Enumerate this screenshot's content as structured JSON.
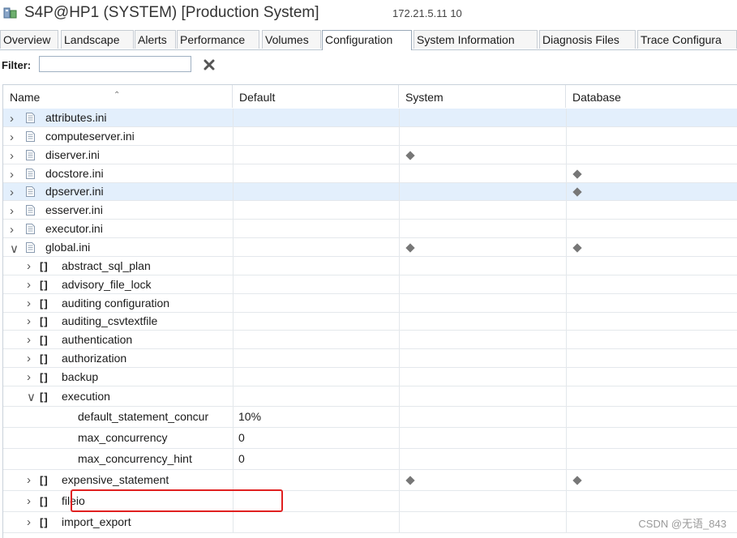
{
  "window": {
    "title": "S4P@HP1 (SYSTEM) [Production System]",
    "host": "172.21.5.11 10"
  },
  "tabs": [
    {
      "label": "Overview",
      "active": false
    },
    {
      "label": "Landscape",
      "active": false
    },
    {
      "label": "Alerts",
      "active": false
    },
    {
      "label": "Performance",
      "active": false
    },
    {
      "label": "Volumes",
      "active": false
    },
    {
      "label": "Configuration",
      "active": true
    },
    {
      "label": "System Information",
      "active": false
    },
    {
      "label": "Diagnosis Files",
      "active": false
    },
    {
      "label": "Trace Configura",
      "active": false
    }
  ],
  "filter": {
    "label": "Filter:",
    "value": "",
    "clear_icon": "x-clear-icon"
  },
  "columns": [
    "Name",
    "Default",
    "System",
    "Database"
  ],
  "rows": [
    {
      "name": "attributes.ini",
      "kind": "file",
      "expanded": false,
      "default": "",
      "system": false,
      "database": false,
      "selected": true
    },
    {
      "name": "computeserver.ini",
      "kind": "file",
      "expanded": false,
      "default": "",
      "system": false,
      "database": false
    },
    {
      "name": "diserver.ini",
      "kind": "file",
      "expanded": false,
      "default": "",
      "system": true,
      "database": false
    },
    {
      "name": "docstore.ini",
      "kind": "file",
      "expanded": false,
      "default": "",
      "system": false,
      "database": true
    },
    {
      "name": "dpserver.ini",
      "kind": "file",
      "expanded": false,
      "default": "",
      "system": false,
      "database": true,
      "selected": true
    },
    {
      "name": "esserver.ini",
      "kind": "file",
      "expanded": false,
      "default": "",
      "system": false,
      "database": false
    },
    {
      "name": "executor.ini",
      "kind": "file",
      "expanded": false,
      "default": "",
      "system": false,
      "database": false
    },
    {
      "name": "global.ini",
      "kind": "file",
      "expanded": true,
      "default": "",
      "system": true,
      "database": true
    },
    {
      "name": "abstract_sql_plan",
      "kind": "section",
      "expanded": false
    },
    {
      "name": "advisory_file_lock",
      "kind": "section",
      "expanded": false
    },
    {
      "name": "auditing configuration",
      "kind": "section",
      "expanded": false
    },
    {
      "name": "auditing_csvtextfile",
      "kind": "section",
      "expanded": false
    },
    {
      "name": "authentication",
      "kind": "section",
      "expanded": false
    },
    {
      "name": "authorization",
      "kind": "section",
      "expanded": false
    },
    {
      "name": "backup",
      "kind": "section",
      "expanded": false
    },
    {
      "name": "execution",
      "kind": "section",
      "expanded": true
    },
    {
      "name": "default_statement_concur",
      "kind": "param",
      "default": "10%"
    },
    {
      "name": "max_concurrency",
      "kind": "param",
      "default": "0"
    },
    {
      "name": "max_concurrency_hint",
      "kind": "param",
      "default": "0"
    },
    {
      "name": "expensive_statement",
      "kind": "section",
      "expanded": false,
      "system": true,
      "database": true
    },
    {
      "name": "fileio",
      "kind": "section",
      "expanded": false
    },
    {
      "name": "import_export",
      "kind": "section",
      "expanded": false
    }
  ],
  "watermark": "CSDN @无语_843",
  "colors": {
    "accent_highlight": "#e02020",
    "selected_row": "#e3effc",
    "marker": "#777777"
  }
}
